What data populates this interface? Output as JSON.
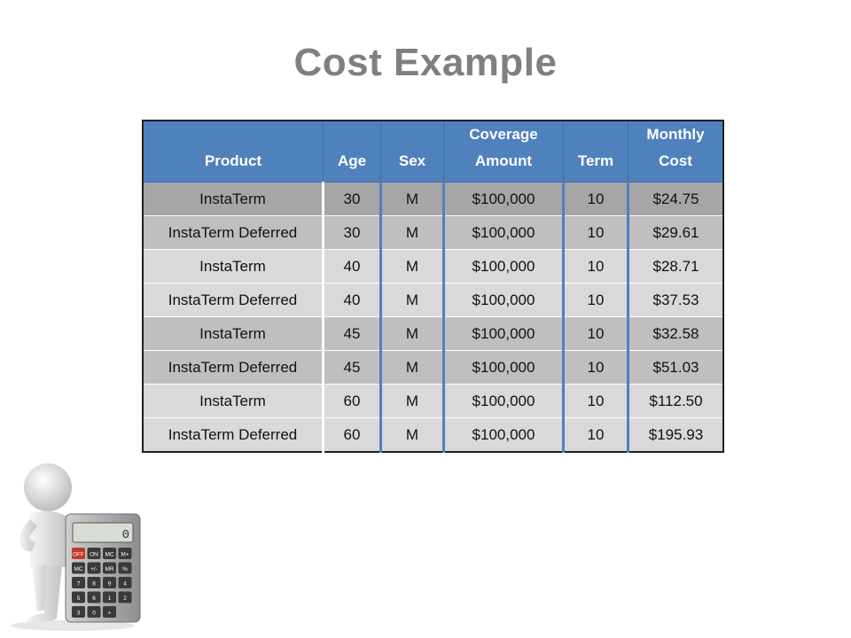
{
  "slide": {
    "title": "Cost Example"
  },
  "table": {
    "headers": [
      "Product",
      "Age",
      "Sex",
      "Coverage Amount",
      "Term",
      "Monthly Cost"
    ],
    "header_lines": [
      [
        "Product"
      ],
      [
        "Age"
      ],
      [
        "Sex"
      ],
      [
        "Coverage",
        "Amount"
      ],
      [
        "Term"
      ],
      [
        "Monthly",
        "Cost"
      ]
    ],
    "rows": [
      [
        "InstaTerm",
        "30",
        "M",
        "$100,000",
        "10",
        "$24.75"
      ],
      [
        "InstaTerm Deferred",
        "30",
        "M",
        "$100,000",
        "10",
        "$29.61"
      ],
      [
        "InstaTerm",
        "40",
        "M",
        "$100,000",
        "10",
        "$28.71"
      ],
      [
        "InstaTerm Deferred",
        "40",
        "M",
        "$100,000",
        "10",
        "$37.53"
      ],
      [
        "InstaTerm",
        "45",
        "M",
        "$100,000",
        "10",
        "$32.58"
      ],
      [
        "InstaTerm Deferred",
        "45",
        "M",
        "$100,000",
        "10",
        "$51.03"
      ],
      [
        "InstaTerm",
        "60",
        "M",
        "$100,000",
        "10",
        "$112.50"
      ],
      [
        "InstaTerm Deferred",
        "60",
        "M",
        "$100,000",
        "10",
        "$195.93"
      ]
    ],
    "row_shades": [
      "dark",
      "mid",
      "light",
      "light",
      "mid",
      "mid",
      "light",
      "light"
    ],
    "colors": {
      "header_bg": "#4f81bd",
      "header_text": "#ffffff",
      "title_text": "#7f7f7f"
    }
  },
  "illustration": {
    "icon": "person-with-calculator-icon",
    "calculator_keys": [
      "OFF",
      "ON",
      "MC",
      "M+",
      "MC",
      "+/-",
      "MR",
      "%",
      "7",
      "8",
      "9",
      "4",
      "5",
      "6",
      "1",
      "2",
      "3",
      "0",
      "+"
    ],
    "display": "0"
  }
}
